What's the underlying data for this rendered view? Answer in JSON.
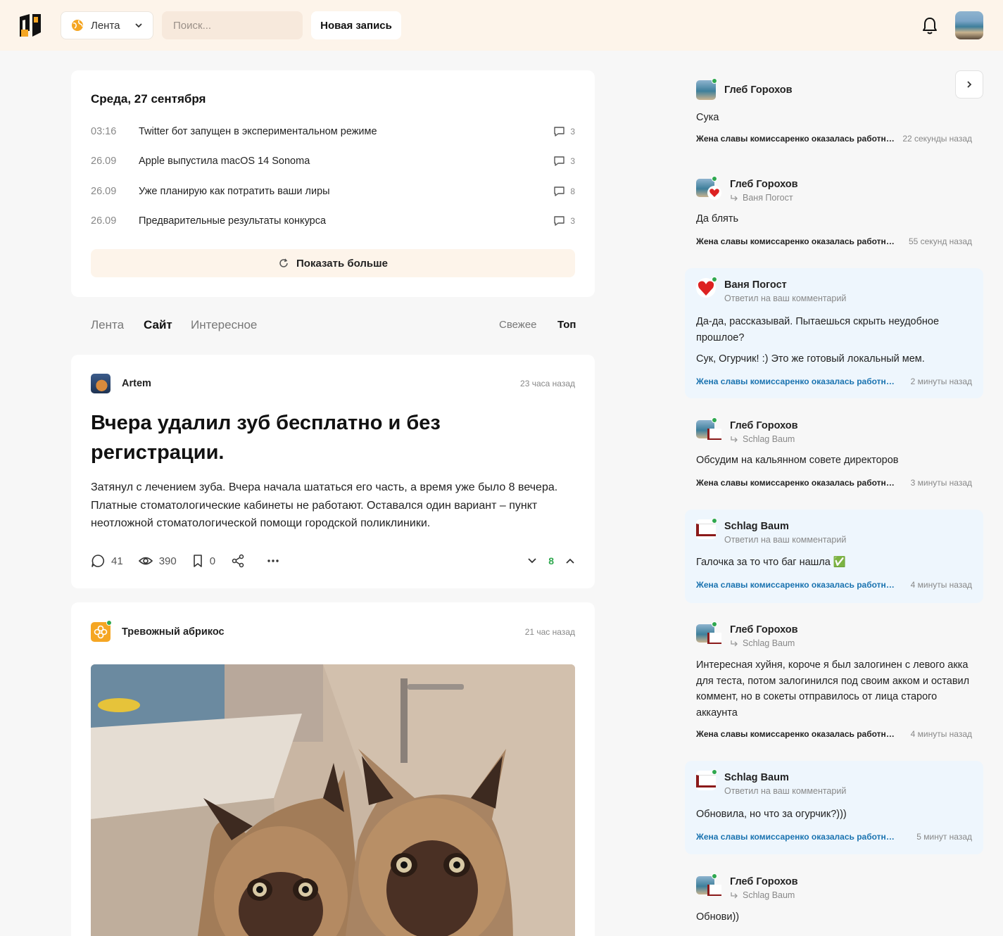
{
  "header": {
    "feed_select": "Лента",
    "search_placeholder": "Поиск...",
    "new_post": "Новая запись"
  },
  "news": {
    "title": "Среда, 27 сентября",
    "items": [
      {
        "time": "03:16",
        "title": "Twitter бот запущен в экспериментальном режиме",
        "comments": "3"
      },
      {
        "time": "26.09",
        "title": "Apple выпустила macOS 14 Sonoma",
        "comments": "3"
      },
      {
        "time": "26.09",
        "title": "Уже планирую как потратить ваши лиры",
        "comments": "8"
      },
      {
        "time": "26.09",
        "title": "Предварительные результаты конкурса",
        "comments": "3"
      }
    ],
    "show_more": "Показать больше"
  },
  "tabs": {
    "items": [
      "Лента",
      "Сайт",
      "Интересное"
    ],
    "active": "Сайт",
    "sort": [
      "Свежее",
      "Топ"
    ],
    "sort_active": "Топ"
  },
  "posts": [
    {
      "author": "Artem",
      "time": "23 часа назад",
      "title": "Вчера удалил зуб бесплатно и без регистрации.",
      "text": "Затянул с лечением зуба. Вчера начала шататься его часть, а время уже было 8 вечера. Платные стоматологические кабинеты не работают. Оставался один вариант – пункт неотложной стоматологической помощи городской поликлиники.",
      "comments": "41",
      "views": "390",
      "bookmarks": "0",
      "rating": "8"
    },
    {
      "author": "Тревожный абрикос",
      "time": "21 час назад"
    }
  ],
  "comments": [
    {
      "name": "Глеб Горохов",
      "reply_to": "",
      "text": "Сука",
      "post": "Жена славы комиссаренко оказалась работница ОФ",
      "time": "22 секунды назад"
    },
    {
      "name": "Глеб Горохов",
      "reply_to": "Ваня Погост",
      "text": "Да блять",
      "post": "Жена славы комиссаренко оказалась работница ОФ",
      "time": "55 секунд назад"
    },
    {
      "name": "Ваня Погост",
      "reply_to": "Ответил на ваш комментарий",
      "text": "Да-да, рассказывай. Пытаешься скрыть неудобное прошлое?",
      "text2": "Сук, Огурчик! :) Это же готовый локальный мем.",
      "post": "Жена славы комиссаренко оказалась работница ОФ",
      "time": "2 минуты назад"
    },
    {
      "name": "Глеб Горохов",
      "reply_to": "Schlag Baum",
      "text": "Обсудим на кальянном совете директоров",
      "post": "Жена славы комиссаренко оказалась работница ОФ",
      "time": "3 минуты назад"
    },
    {
      "name": "Schlag Baum",
      "reply_to": "Ответил на ваш комментарий",
      "text": "Галочка за то что баг нашла ✅",
      "post": "Жена славы комиссаренко оказалась работница ОФ",
      "time": "4 минуты назад"
    },
    {
      "name": "Глеб Горохов",
      "reply_to": "Schlag Baum",
      "text": "Интересная хуйня, короче я был залогинен с левого акка для теста, потом залогинился под своим акком и оставил коммент, но в сокеты отправилось от лица старого аккаунта",
      "post": "Жена славы комиссаренко оказалась работница ОФ",
      "time": "4 минуты назад"
    },
    {
      "name": "Schlag Baum",
      "reply_to": "Ответил на ваш комментарий",
      "text": "Обновила, но что за огурчик?)))",
      "post": "Жена славы комиссаренко оказалась работница ОФ",
      "time": "5 минут назад"
    },
    {
      "name": "Глеб Горохов",
      "reply_to": "Schlag Baum",
      "text": "Обнови))",
      "post": "",
      "time": ""
    }
  ],
  "colors": {
    "header_bg": "#fdf4ea",
    "accent_orange": "#f5a623",
    "online": "#2fa84f",
    "highlight_bg": "#eef6fd",
    "link_blue": "#1a73b0"
  },
  "icons": [
    "logo-icon",
    "globe-icon",
    "chevron-down-icon",
    "bell-icon",
    "comment-icon",
    "refresh-icon",
    "eye-icon",
    "bookmark-icon",
    "share-icon",
    "more-icon",
    "chevron-up-icon",
    "chevron-right-icon",
    "reply-arrow-icon"
  ]
}
